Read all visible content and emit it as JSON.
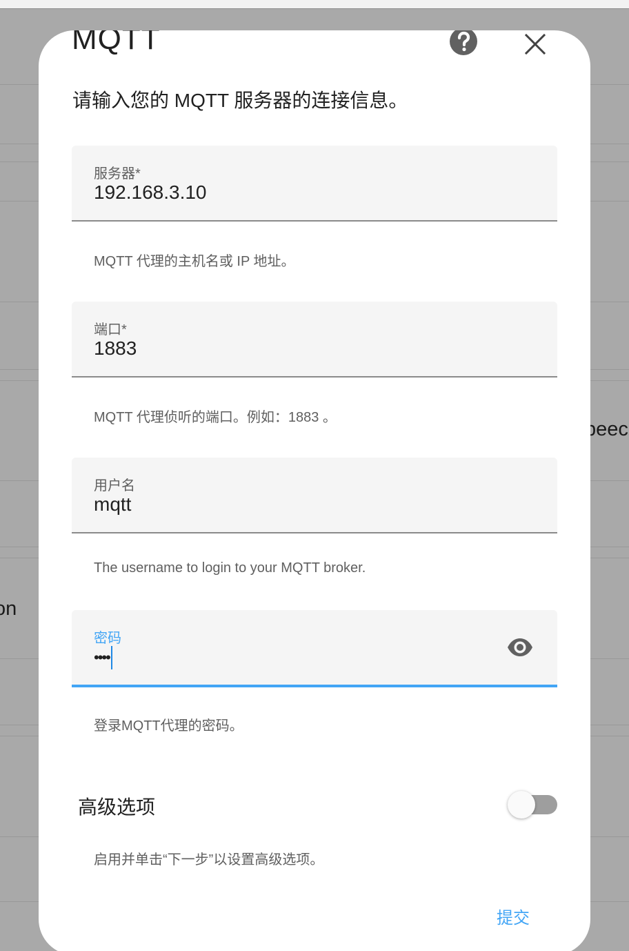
{
  "background": {
    "visible_text_right": "peec",
    "visible_text_left": "on"
  },
  "dialog": {
    "title": "MQTT",
    "help_icon": "help-circle-icon",
    "close_icon": "close-icon",
    "intro": "请输入您的 MQTT 服务器的连接信息。",
    "fields": {
      "broker": {
        "label": "服务器*",
        "value": "192.168.3.10",
        "helper": "MQTT 代理的主机名或 IP 地址。"
      },
      "port": {
        "label": "端口*",
        "value": "1883",
        "helper": "MQTT 代理侦听的端口。例如：1883 。"
      },
      "username": {
        "label": "用户名",
        "value": "mqtt",
        "helper": "The username to login to your MQTT broker."
      },
      "password": {
        "label": "密码",
        "value": "••••",
        "helper": "登录MQTT代理的密码。",
        "reveal_icon": "eye-icon"
      }
    },
    "advanced": {
      "label": "高级选项",
      "enabled": false,
      "helper": "启用并单击“下一步”以设置高级选项。"
    },
    "submit_label": "提交"
  },
  "colors": {
    "accent": "#42a5f5",
    "scrim_background": "#a9a9a9",
    "field_background": "#f5f5f5"
  }
}
